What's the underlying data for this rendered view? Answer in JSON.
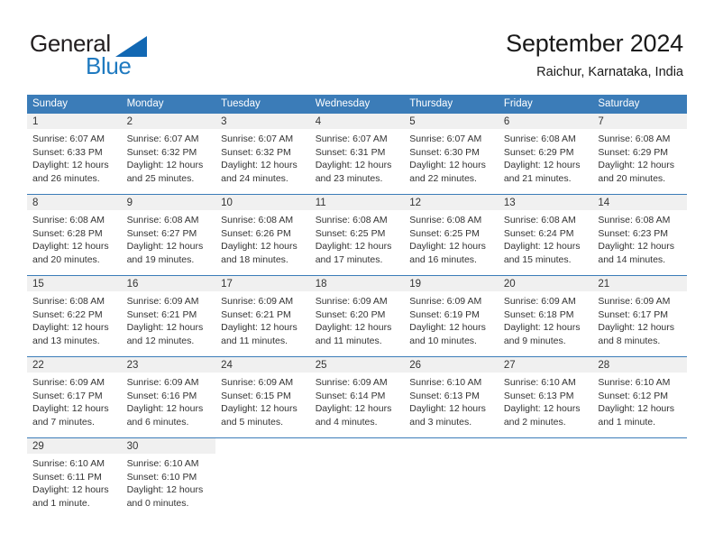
{
  "brand": {
    "name_part1": "General",
    "name_part2": "Blue",
    "logo_icon": "triangle-logo-icon",
    "colors": {
      "dark": "#231f20",
      "blue": "#1f7ac0",
      "triangle": "#1268b3"
    }
  },
  "header": {
    "title": "September 2024",
    "subtitle": "Raichur, Karnataka, India"
  },
  "theme": {
    "header_row_bg": "#3b7cb8",
    "header_row_text": "#ffffff",
    "daynum_band_bg": "#f0f0f0",
    "row_divider": "#3b7cb8",
    "cell_bg": "#ffffff"
  },
  "weekdays": [
    "Sunday",
    "Monday",
    "Tuesday",
    "Wednesday",
    "Thursday",
    "Friday",
    "Saturday"
  ],
  "weeks": [
    [
      {
        "day": "1",
        "sunrise": "Sunrise: 6:07 AM",
        "sunset": "Sunset: 6:33 PM",
        "daylight_line1": "Daylight: 12 hours",
        "daylight_line2": "and 26 minutes."
      },
      {
        "day": "2",
        "sunrise": "Sunrise: 6:07 AM",
        "sunset": "Sunset: 6:32 PM",
        "daylight_line1": "Daylight: 12 hours",
        "daylight_line2": "and 25 minutes."
      },
      {
        "day": "3",
        "sunrise": "Sunrise: 6:07 AM",
        "sunset": "Sunset: 6:32 PM",
        "daylight_line1": "Daylight: 12 hours",
        "daylight_line2": "and 24 minutes."
      },
      {
        "day": "4",
        "sunrise": "Sunrise: 6:07 AM",
        "sunset": "Sunset: 6:31 PM",
        "daylight_line1": "Daylight: 12 hours",
        "daylight_line2": "and 23 minutes."
      },
      {
        "day": "5",
        "sunrise": "Sunrise: 6:07 AM",
        "sunset": "Sunset: 6:30 PM",
        "daylight_line1": "Daylight: 12 hours",
        "daylight_line2": "and 22 minutes."
      },
      {
        "day": "6",
        "sunrise": "Sunrise: 6:08 AM",
        "sunset": "Sunset: 6:29 PM",
        "daylight_line1": "Daylight: 12 hours",
        "daylight_line2": "and 21 minutes."
      },
      {
        "day": "7",
        "sunrise": "Sunrise: 6:08 AM",
        "sunset": "Sunset: 6:29 PM",
        "daylight_line1": "Daylight: 12 hours",
        "daylight_line2": "and 20 minutes."
      }
    ],
    [
      {
        "day": "8",
        "sunrise": "Sunrise: 6:08 AM",
        "sunset": "Sunset: 6:28 PM",
        "daylight_line1": "Daylight: 12 hours",
        "daylight_line2": "and 20 minutes."
      },
      {
        "day": "9",
        "sunrise": "Sunrise: 6:08 AM",
        "sunset": "Sunset: 6:27 PM",
        "daylight_line1": "Daylight: 12 hours",
        "daylight_line2": "and 19 minutes."
      },
      {
        "day": "10",
        "sunrise": "Sunrise: 6:08 AM",
        "sunset": "Sunset: 6:26 PM",
        "daylight_line1": "Daylight: 12 hours",
        "daylight_line2": "and 18 minutes."
      },
      {
        "day": "11",
        "sunrise": "Sunrise: 6:08 AM",
        "sunset": "Sunset: 6:25 PM",
        "daylight_line1": "Daylight: 12 hours",
        "daylight_line2": "and 17 minutes."
      },
      {
        "day": "12",
        "sunrise": "Sunrise: 6:08 AM",
        "sunset": "Sunset: 6:25 PM",
        "daylight_line1": "Daylight: 12 hours",
        "daylight_line2": "and 16 minutes."
      },
      {
        "day": "13",
        "sunrise": "Sunrise: 6:08 AM",
        "sunset": "Sunset: 6:24 PM",
        "daylight_line1": "Daylight: 12 hours",
        "daylight_line2": "and 15 minutes."
      },
      {
        "day": "14",
        "sunrise": "Sunrise: 6:08 AM",
        "sunset": "Sunset: 6:23 PM",
        "daylight_line1": "Daylight: 12 hours",
        "daylight_line2": "and 14 minutes."
      }
    ],
    [
      {
        "day": "15",
        "sunrise": "Sunrise: 6:08 AM",
        "sunset": "Sunset: 6:22 PM",
        "daylight_line1": "Daylight: 12 hours",
        "daylight_line2": "and 13 minutes."
      },
      {
        "day": "16",
        "sunrise": "Sunrise: 6:09 AM",
        "sunset": "Sunset: 6:21 PM",
        "daylight_line1": "Daylight: 12 hours",
        "daylight_line2": "and 12 minutes."
      },
      {
        "day": "17",
        "sunrise": "Sunrise: 6:09 AM",
        "sunset": "Sunset: 6:21 PM",
        "daylight_line1": "Daylight: 12 hours",
        "daylight_line2": "and 11 minutes."
      },
      {
        "day": "18",
        "sunrise": "Sunrise: 6:09 AM",
        "sunset": "Sunset: 6:20 PM",
        "daylight_line1": "Daylight: 12 hours",
        "daylight_line2": "and 11 minutes."
      },
      {
        "day": "19",
        "sunrise": "Sunrise: 6:09 AM",
        "sunset": "Sunset: 6:19 PM",
        "daylight_line1": "Daylight: 12 hours",
        "daylight_line2": "and 10 minutes."
      },
      {
        "day": "20",
        "sunrise": "Sunrise: 6:09 AM",
        "sunset": "Sunset: 6:18 PM",
        "daylight_line1": "Daylight: 12 hours",
        "daylight_line2": "and 9 minutes."
      },
      {
        "day": "21",
        "sunrise": "Sunrise: 6:09 AM",
        "sunset": "Sunset: 6:17 PM",
        "daylight_line1": "Daylight: 12 hours",
        "daylight_line2": "and 8 minutes."
      }
    ],
    [
      {
        "day": "22",
        "sunrise": "Sunrise: 6:09 AM",
        "sunset": "Sunset: 6:17 PM",
        "daylight_line1": "Daylight: 12 hours",
        "daylight_line2": "and 7 minutes."
      },
      {
        "day": "23",
        "sunrise": "Sunrise: 6:09 AM",
        "sunset": "Sunset: 6:16 PM",
        "daylight_line1": "Daylight: 12 hours",
        "daylight_line2": "and 6 minutes."
      },
      {
        "day": "24",
        "sunrise": "Sunrise: 6:09 AM",
        "sunset": "Sunset: 6:15 PM",
        "daylight_line1": "Daylight: 12 hours",
        "daylight_line2": "and 5 minutes."
      },
      {
        "day": "25",
        "sunrise": "Sunrise: 6:09 AM",
        "sunset": "Sunset: 6:14 PM",
        "daylight_line1": "Daylight: 12 hours",
        "daylight_line2": "and 4 minutes."
      },
      {
        "day": "26",
        "sunrise": "Sunrise: 6:10 AM",
        "sunset": "Sunset: 6:13 PM",
        "daylight_line1": "Daylight: 12 hours",
        "daylight_line2": "and 3 minutes."
      },
      {
        "day": "27",
        "sunrise": "Sunrise: 6:10 AM",
        "sunset": "Sunset: 6:13 PM",
        "daylight_line1": "Daylight: 12 hours",
        "daylight_line2": "and 2 minutes."
      },
      {
        "day": "28",
        "sunrise": "Sunrise: 6:10 AM",
        "sunset": "Sunset: 6:12 PM",
        "daylight_line1": "Daylight: 12 hours",
        "daylight_line2": "and 1 minute."
      }
    ],
    [
      {
        "day": "29",
        "sunrise": "Sunrise: 6:10 AM",
        "sunset": "Sunset: 6:11 PM",
        "daylight_line1": "Daylight: 12 hours",
        "daylight_line2": "and 1 minute."
      },
      {
        "day": "30",
        "sunrise": "Sunrise: 6:10 AM",
        "sunset": "Sunset: 6:10 PM",
        "daylight_line1": "Daylight: 12 hours",
        "daylight_line2": "and 0 minutes."
      },
      null,
      null,
      null,
      null,
      null
    ]
  ]
}
